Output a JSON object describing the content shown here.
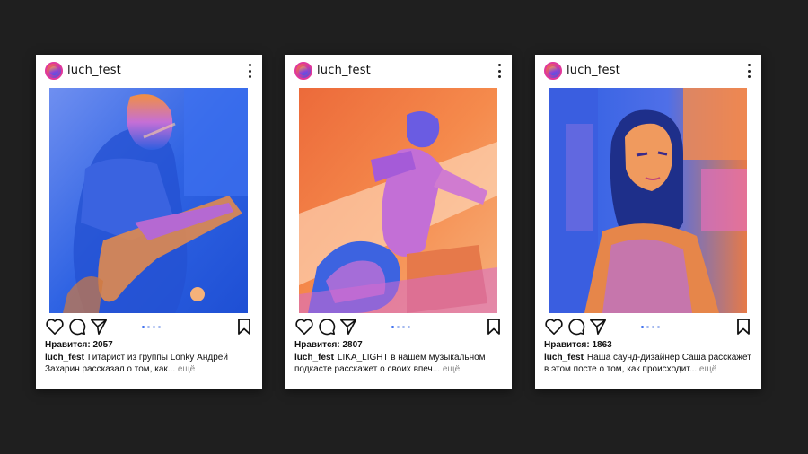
{
  "posts": [
    {
      "username": "luch_fest",
      "likes": "Нравится: 2057",
      "caption_user": "luch_fest",
      "caption": "Гитарист из группы Lonky Андрей Захарин рассказал о том, как...",
      "more": "ещё",
      "photo": "guitarist-photo"
    },
    {
      "username": "luch_fest",
      "likes": "Нравится: 2807",
      "caption_user": "luch_fest",
      "caption": "LIKA_LIGHT в нашем музыкальном подкасте расскажет о своих впеч...",
      "more": "ещё",
      "photo": "singer-photo"
    },
    {
      "username": "luch_fest",
      "likes": "Нравится: 1863",
      "caption_user": "luch_fest",
      "caption": "Наша саунд-дизайнер Саша расскажет в этом посте о том, как происходит...",
      "more": "ещё",
      "photo": "sound-designer-photo"
    }
  ],
  "icons": [
    "heart-icon",
    "comment-icon",
    "share-icon",
    "bookmark-icon",
    "more-options-icon"
  ],
  "colors": {
    "background": "#1f1f1f",
    "card": "#ffffff",
    "carousel_dot": "#3b6ef0"
  }
}
